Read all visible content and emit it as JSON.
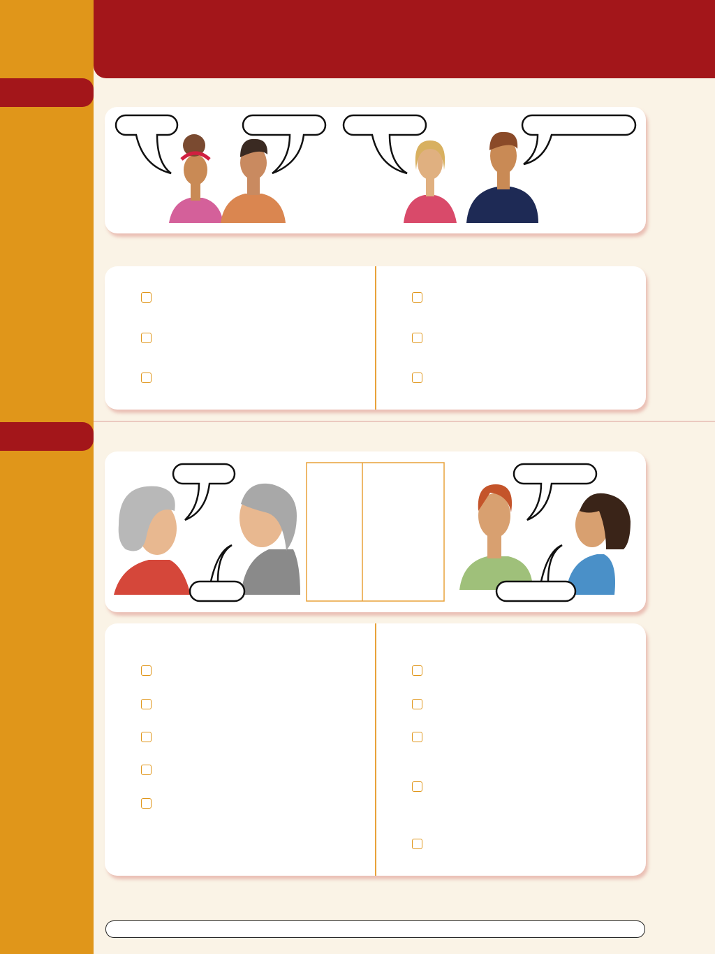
{
  "colors": {
    "sidebar": "#E0961A",
    "header": "#A3161A",
    "background": "#FAF3E6",
    "card": "#FFFFFF",
    "checkbox_border": "#E0961A"
  },
  "section1": {
    "illustration_icons": [
      "speech-bubble",
      "speech-bubble",
      "speech-bubble",
      "speech-bubble"
    ],
    "checklist_left": [
      {
        "checked": false
      },
      {
        "checked": false
      },
      {
        "checked": false
      }
    ],
    "checklist_right": [
      {
        "checked": false
      },
      {
        "checked": false
      },
      {
        "checked": false
      }
    ]
  },
  "section2": {
    "illustration_icons": [
      "speech-bubble",
      "speech-bubble",
      "speech-bubble",
      "speech-bubble"
    ],
    "checklist_left": [
      {
        "checked": false
      },
      {
        "checked": false
      },
      {
        "checked": false
      },
      {
        "checked": false
      },
      {
        "checked": false
      }
    ],
    "checklist_right": [
      {
        "checked": false
      },
      {
        "checked": false
      },
      {
        "checked": false
      },
      {
        "checked": false
      },
      {
        "checked": false
      }
    ]
  }
}
